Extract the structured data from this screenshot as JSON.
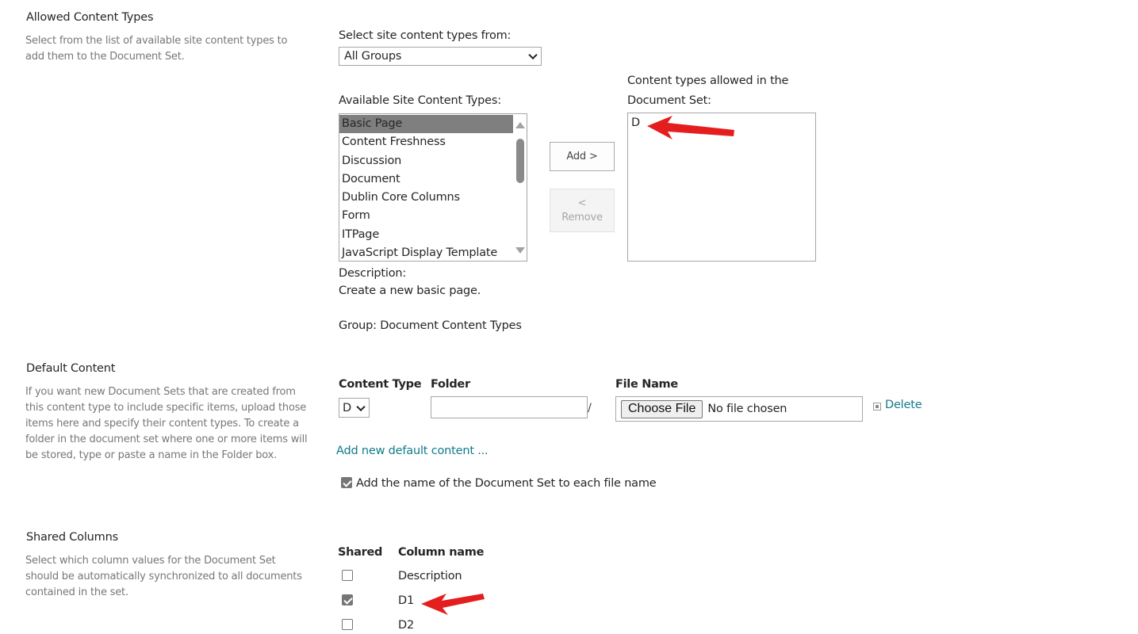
{
  "allowed_content_types": {
    "title": "Allowed Content Types",
    "description": "Select from the list of available site content types to add them to the Document Set.",
    "select_from_label": "Select site content types from:",
    "group_select_value": "All Groups",
    "available_label": "Available Site Content Types:",
    "available_items": [
      {
        "label": "Basic Page",
        "selected": true
      },
      {
        "label": "Content Freshness",
        "selected": false
      },
      {
        "label": "Discussion",
        "selected": false
      },
      {
        "label": "Document",
        "selected": false
      },
      {
        "label": "Dublin Core Columns",
        "selected": false
      },
      {
        "label": "Form",
        "selected": false
      },
      {
        "label": "ITPage",
        "selected": false
      },
      {
        "label": "JavaScript Display Template",
        "selected": false
      }
    ],
    "add_button": "Add >",
    "remove_button_arrow": "<",
    "remove_button": "Remove",
    "allowed_label_line1": "Content types allowed in the",
    "allowed_label_line2": "Document Set:",
    "allowed_items": [
      "D"
    ],
    "description_label": "Description:",
    "description_value": "Create a new basic page.",
    "group_text": "Group: Document Content Types"
  },
  "default_content": {
    "title": "Default Content",
    "description": "If you want new Document Sets that are created from this content type to include specific items, upload those items here and specify their content types. To create a folder in the document set where one or more items will be stored, type or paste a name in the Folder box.",
    "col_content_type": "Content Type",
    "col_folder": "Folder",
    "col_file_name": "File Name",
    "content_type_value": "D",
    "folder_value": "",
    "folder_separator": "/",
    "choose_file_label": "Choose File",
    "no_file_text": "No file chosen",
    "delete_link": "Delete",
    "add_new_link": "Add new default content ...",
    "add_name_checkbox_label": "Add the name of the Document Set to each file name",
    "add_name_checked": true
  },
  "shared_columns": {
    "title": "Shared Columns",
    "description": "Select which column values for the Document Set should be automatically synchronized to all documents contained in the set.",
    "col_shared": "Shared",
    "col_name": "Column name",
    "rows": [
      {
        "name": "Description",
        "checked": false
      },
      {
        "name": "D1",
        "checked": true
      },
      {
        "name": "D2",
        "checked": false
      }
    ]
  },
  "colors": {
    "link": "#0f7b8a",
    "annotation_arrow": "#e41e1e",
    "selected_item_bg": "#7f7f7f"
  }
}
